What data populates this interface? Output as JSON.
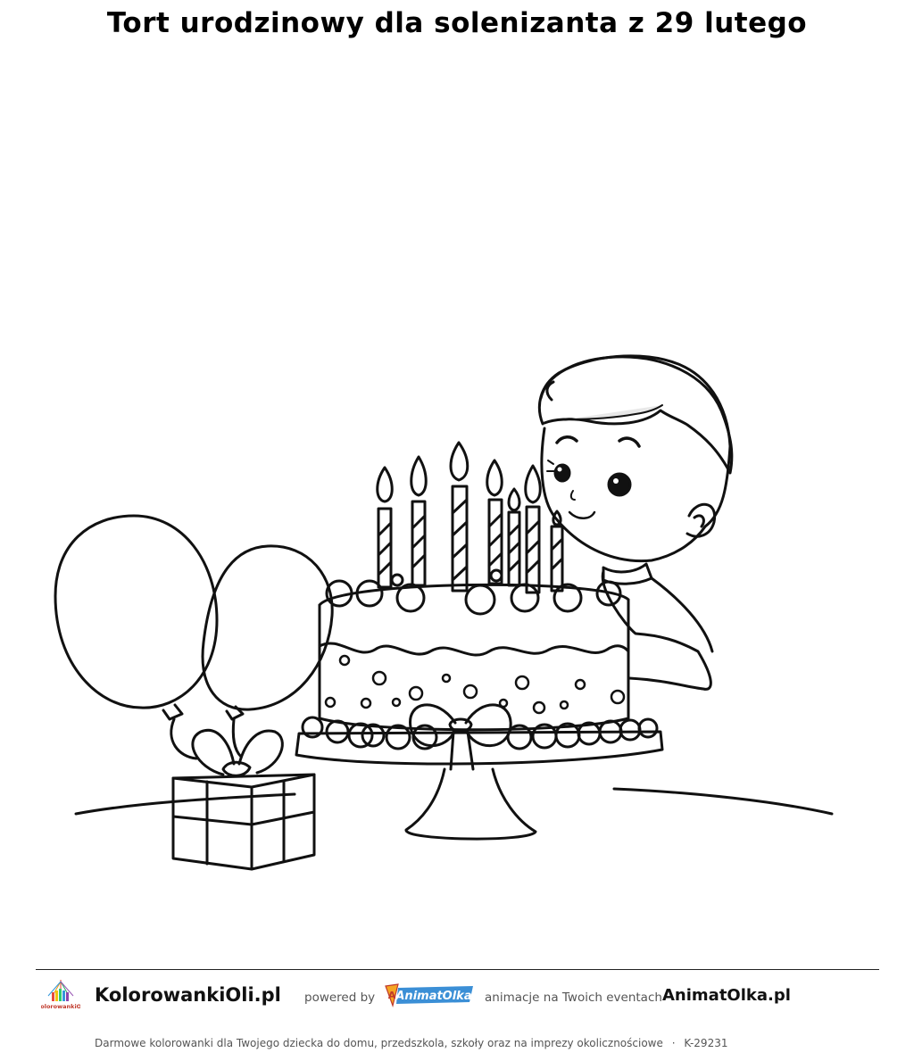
{
  "page": {
    "title": "Tort urodzinowy dla solenizanta z 29 lutego"
  },
  "illustration": {
    "subject": "coloring-page-line-art",
    "elements": [
      "balloon-icon",
      "gift-box-icon",
      "birthday-cake-icon",
      "candle-icon",
      "boy-icon"
    ]
  },
  "footer": {
    "site_name": "KolorowankiOli.pl",
    "powered_by": "powered by",
    "animat_logo_text": "AnimatOlka",
    "tagline": "animacje na Twoich eventach",
    "site2": "AnimatOlka.pl",
    "bottom_text": "Darmowe kolorowanki dla Twojego dziecka do domu, przedszkola, szkoły oraz na imprezy okolicznościowe",
    "separator": "·",
    "code": "K-29231",
    "logo_text": "KolorowankiOli"
  }
}
